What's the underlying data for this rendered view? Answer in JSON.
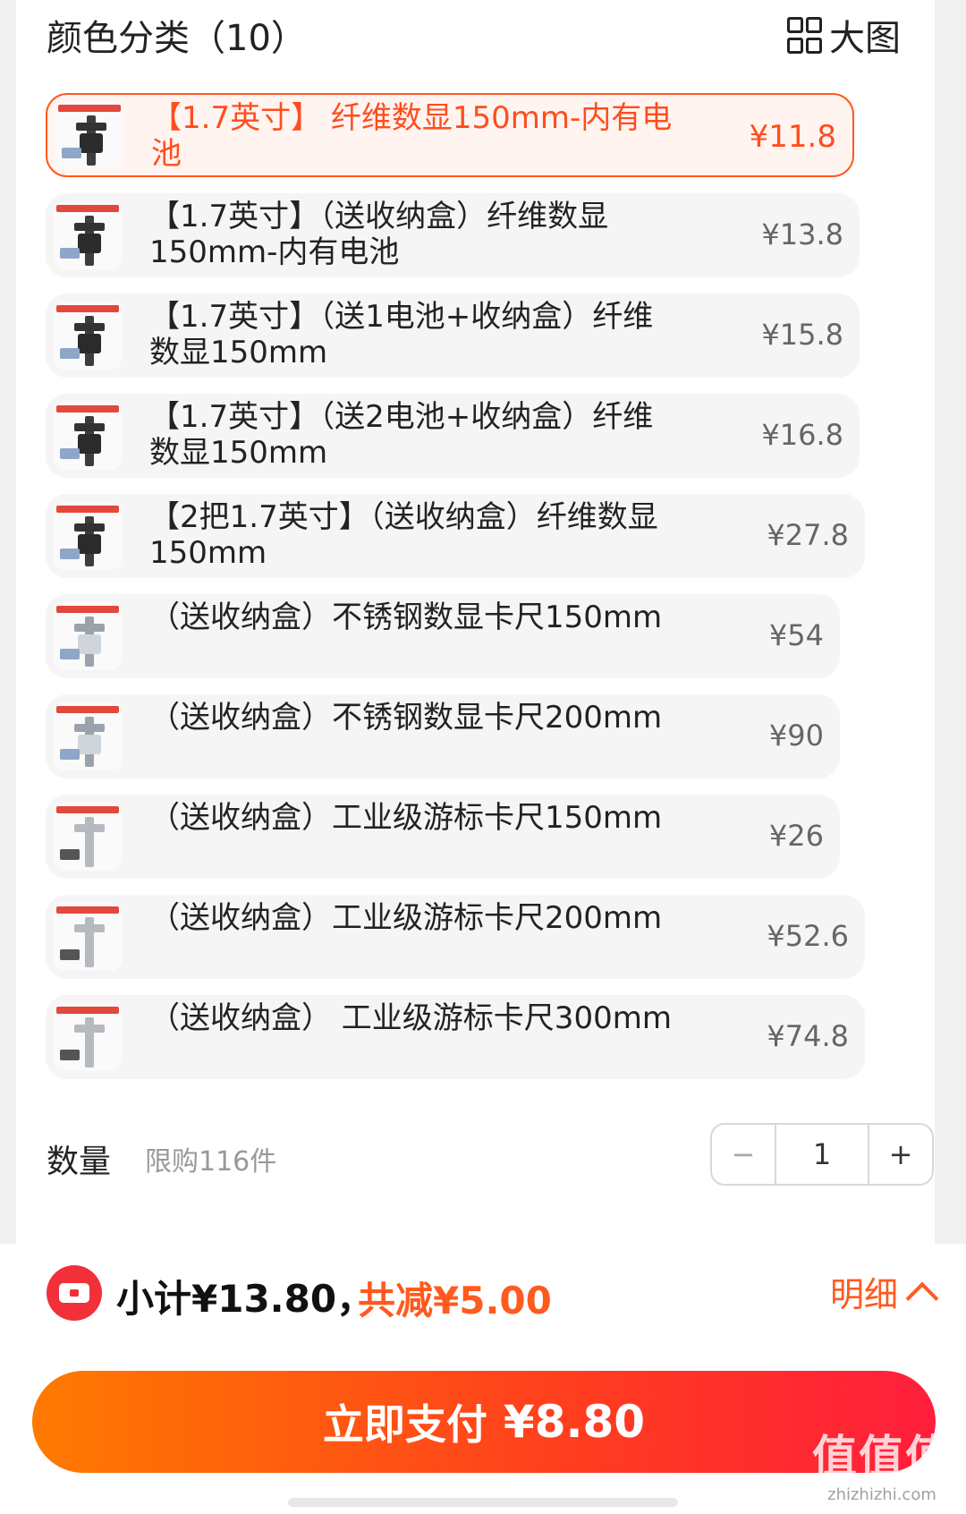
{
  "header": {
    "title": "颜色分类（10）",
    "view_toggle_label": "大图"
  },
  "options": [
    {
      "label": "【1.7英寸】 纤维数显150mm-内有电池",
      "price": "¥11.8",
      "selected": true,
      "thumb": "digital"
    },
    {
      "label": "【1.7英寸】（送收纳盒）纤维数显150mm-内有电池",
      "price": "¥13.8",
      "selected": false,
      "thumb": "digital"
    },
    {
      "label": "【1.7英寸】（送1电池+收纳盒）纤维数显150mm",
      "price": "¥15.8",
      "selected": false,
      "thumb": "digital"
    },
    {
      "label": "【1.7英寸】（送2电池+收纳盒）纤维数显150mm",
      "price": "¥16.8",
      "selected": false,
      "thumb": "digital"
    },
    {
      "label": "【2把1.7英寸】（送收纳盒）纤维数显150mm",
      "price": "¥27.8",
      "selected": false,
      "thumb": "digital"
    },
    {
      "label": "（送收纳盒）不锈钢数显卡尺150mm",
      "price": "¥54",
      "selected": false,
      "thumb": "steel"
    },
    {
      "label": "（送收纳盒）不锈钢数显卡尺200mm",
      "price": "¥90",
      "selected": false,
      "thumb": "steel"
    },
    {
      "label": "（送收纳盒）工业级游标卡尺150mm",
      "price": "¥26",
      "selected": false,
      "thumb": "vernier"
    },
    {
      "label": "（送收纳盒）工业级游标卡尺200mm",
      "price": "¥52.6",
      "selected": false,
      "thumb": "vernier"
    },
    {
      "label": "（送收纳盒） 工业级游标卡尺300mm",
      "price": "¥74.8",
      "selected": false,
      "thumb": "vernier"
    }
  ],
  "quantity": {
    "label": "数量",
    "limit_text": "限购116件",
    "value": "1",
    "minus": "−",
    "plus": "+"
  },
  "summary": {
    "subtotal": "小计¥13.80，",
    "discount": "共减¥5.00",
    "detail_label": "明细"
  },
  "pay": {
    "label": "立即支付",
    "amount": "¥8.80"
  },
  "watermark": {
    "logo": "值值值",
    "url": "zhizhizhi.com"
  },
  "colors": {
    "accent": "#ff5a1f",
    "selected_bg": "#fff4ef",
    "coupon_red": "#f2303a"
  }
}
